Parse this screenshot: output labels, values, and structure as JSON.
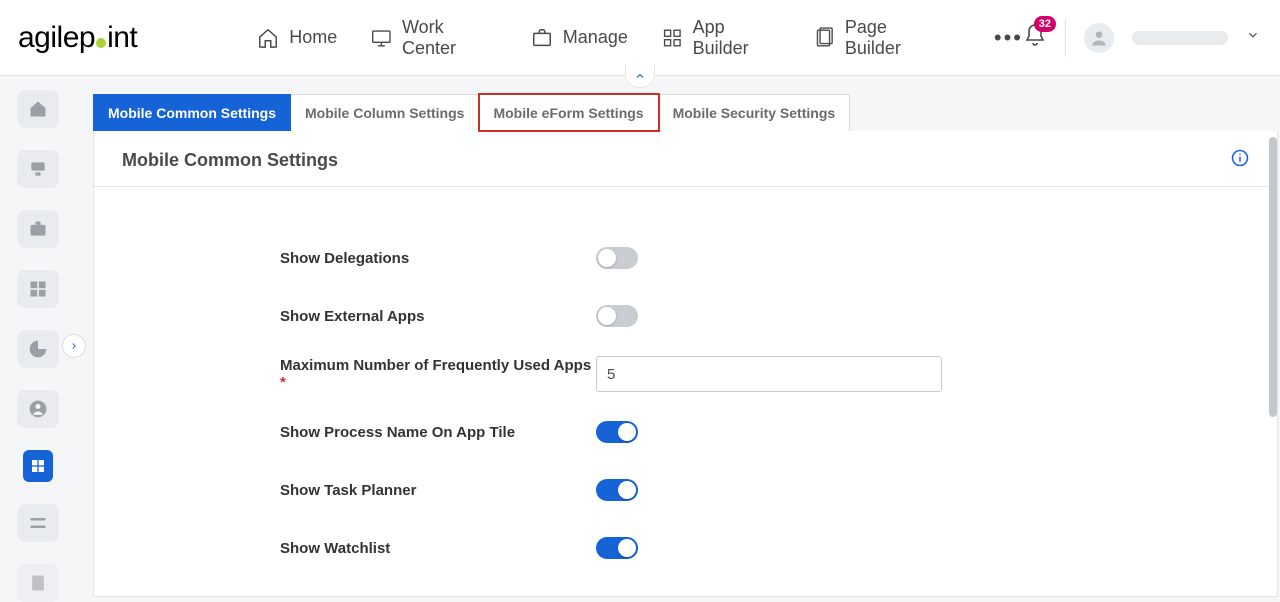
{
  "logo_text_1": "agilep",
  "logo_text_2": "int",
  "notification_count": "32",
  "nav": {
    "home": "Home",
    "work_center": "Work Center",
    "manage": "Manage",
    "app_builder": "App Builder",
    "page_builder": "Page Builder"
  },
  "tabs": {
    "common": "Mobile Common Settings",
    "column": "Mobile Column Settings",
    "eform": "Mobile eForm Settings",
    "security": "Mobile Security Settings"
  },
  "panel_title": "Mobile Common Settings",
  "form": {
    "show_delegations_label": "Show Delegations",
    "show_delegations_on": false,
    "show_external_apps_label": "Show External Apps",
    "show_external_apps_on": false,
    "max_apps_label": "Maximum Number of Frequently Used Apps",
    "max_apps_required": "*",
    "max_apps_value": "5",
    "show_process_name_label": "Show Process Name On App Tile",
    "show_process_name_on": true,
    "show_task_planner_label": "Show Task Planner",
    "show_task_planner_on": true,
    "show_watchlist_label": "Show Watchlist",
    "show_watchlist_on": true
  }
}
